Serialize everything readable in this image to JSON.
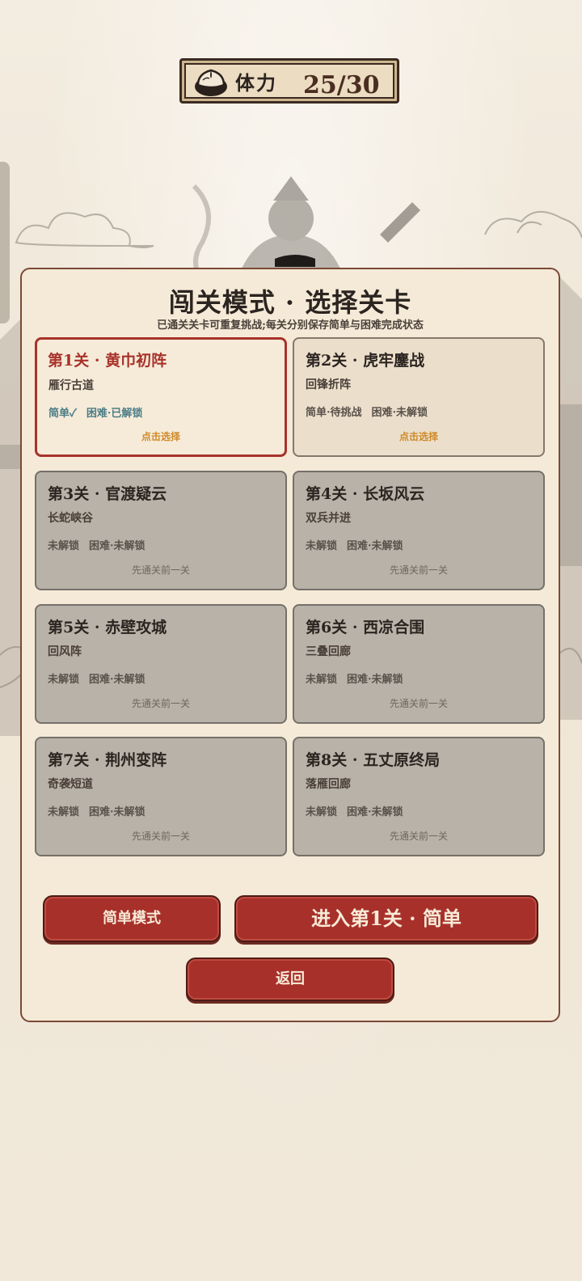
{
  "stamina": {
    "icon": "steamed-bun-icon",
    "label": "体力",
    "value": "25/30"
  },
  "panel": {
    "title": "闯关模式 · 选择关卡",
    "subtitle": "已通关关卡可重复挑战;每关分别保存简单与困难完成状态"
  },
  "levels": [
    {
      "name": "第1关 · 黄巾初阵",
      "subtitle": "雁行古道",
      "easy_status": "简单✓",
      "hard_status": "困难·已解锁",
      "hint": "点击选择",
      "state": "selected"
    },
    {
      "name": "第2关 · 虎牢鏖战",
      "subtitle": "回锋折阵",
      "easy_status": "简单·待挑战",
      "hard_status": "困难·未解锁",
      "hint": "点击选择",
      "state": "available"
    },
    {
      "name": "第3关 · 官渡疑云",
      "subtitle": "长蛇峡谷",
      "easy_status": "未解锁",
      "hard_status": "困难·未解锁",
      "hint": "先通关前一关",
      "state": "locked"
    },
    {
      "name": "第4关 · 长坂风云",
      "subtitle": "双兵并进",
      "easy_status": "未解锁",
      "hard_status": "困难·未解锁",
      "hint": "先通关前一关",
      "state": "locked"
    },
    {
      "name": "第5关 · 赤壁攻城",
      "subtitle": "回风阵",
      "easy_status": "未解锁",
      "hard_status": "困难·未解锁",
      "hint": "先通关前一关",
      "state": "locked"
    },
    {
      "name": "第6关 · 西凉合围",
      "subtitle": "三叠回廊",
      "easy_status": "未解锁",
      "hard_status": "困难·未解锁",
      "hint": "先通关前一关",
      "state": "locked"
    },
    {
      "name": "第7关 · 荆州变阵",
      "subtitle": "奇袭短道",
      "easy_status": "未解锁",
      "hard_status": "困难·未解锁",
      "hint": "先通关前一关",
      "state": "locked"
    },
    {
      "name": "第8关 · 五丈原终局",
      "subtitle": "落雁回廊",
      "easy_status": "未解锁",
      "hard_status": "困难·未解锁",
      "hint": "先通关前一关",
      "state": "locked"
    }
  ],
  "buttons": {
    "mode": "简单模式",
    "enter": "进入第1关 · 简单",
    "back": "返回"
  },
  "colors": {
    "accent_red": "#a8302a",
    "selected_border": "#a8332b",
    "hint_orange": "#cf8a2a",
    "easy_status_teal": "#4b7d86",
    "locked_card": "#b8b2a8"
  }
}
